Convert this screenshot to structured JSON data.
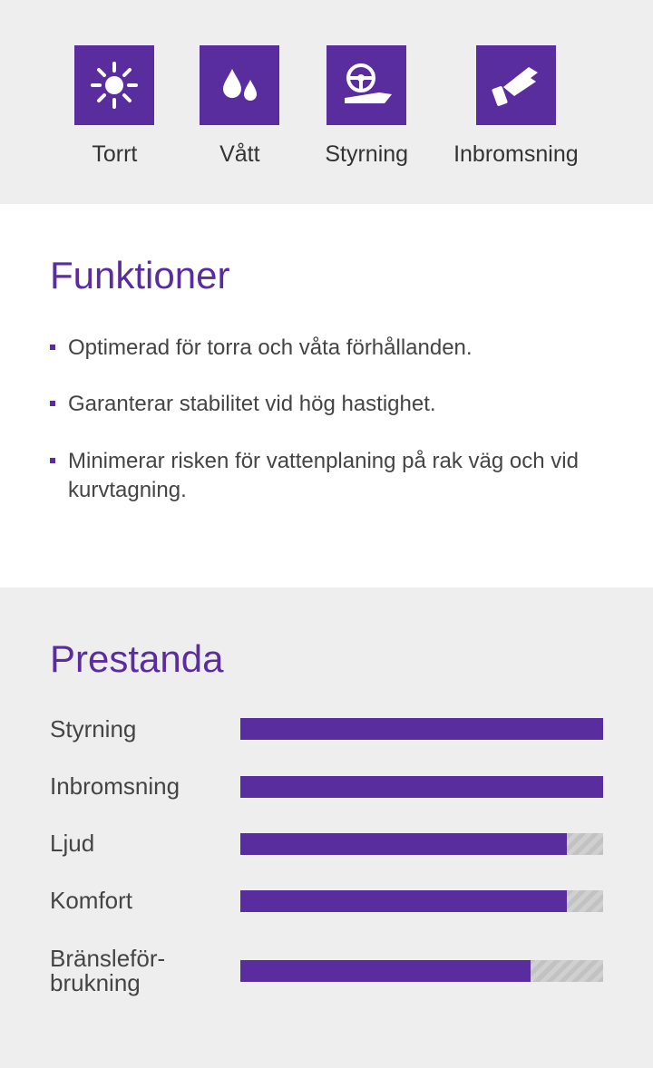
{
  "icons": [
    {
      "name": "dry-icon",
      "label": "Torrt"
    },
    {
      "name": "wet-icon",
      "label": "Vått"
    },
    {
      "name": "steer-icon",
      "label": "Styrning"
    },
    {
      "name": "brake-icon",
      "label": "Inbromsning"
    }
  ],
  "features": {
    "title": "Funktioner",
    "items": [
      "Optimerad för torra och våta förhållanden.",
      "Garanterar stabilitet vid hög hastighet.",
      "Minimerar risken för vattenplaning på rak väg och vid kurvtagning."
    ]
  },
  "performance": {
    "title": "Prestanda",
    "metrics": [
      {
        "label": "Styrning",
        "pct": 100
      },
      {
        "label": "Inbromsning",
        "pct": 100
      },
      {
        "label": "Ljud",
        "pct": 90
      },
      {
        "label": "Komfort",
        "pct": 90
      },
      {
        "label": "Bränsleför-\nbrukning",
        "pct": 80
      }
    ]
  },
  "chart_data": {
    "type": "bar",
    "categories": [
      "Styrning",
      "Inbromsning",
      "Ljud",
      "Komfort",
      "Bränsleförbrukning"
    ],
    "values": [
      100,
      100,
      90,
      90,
      80
    ],
    "title": "Prestanda",
    "xlabel": "",
    "ylabel": "",
    "ylim": [
      0,
      100
    ]
  }
}
